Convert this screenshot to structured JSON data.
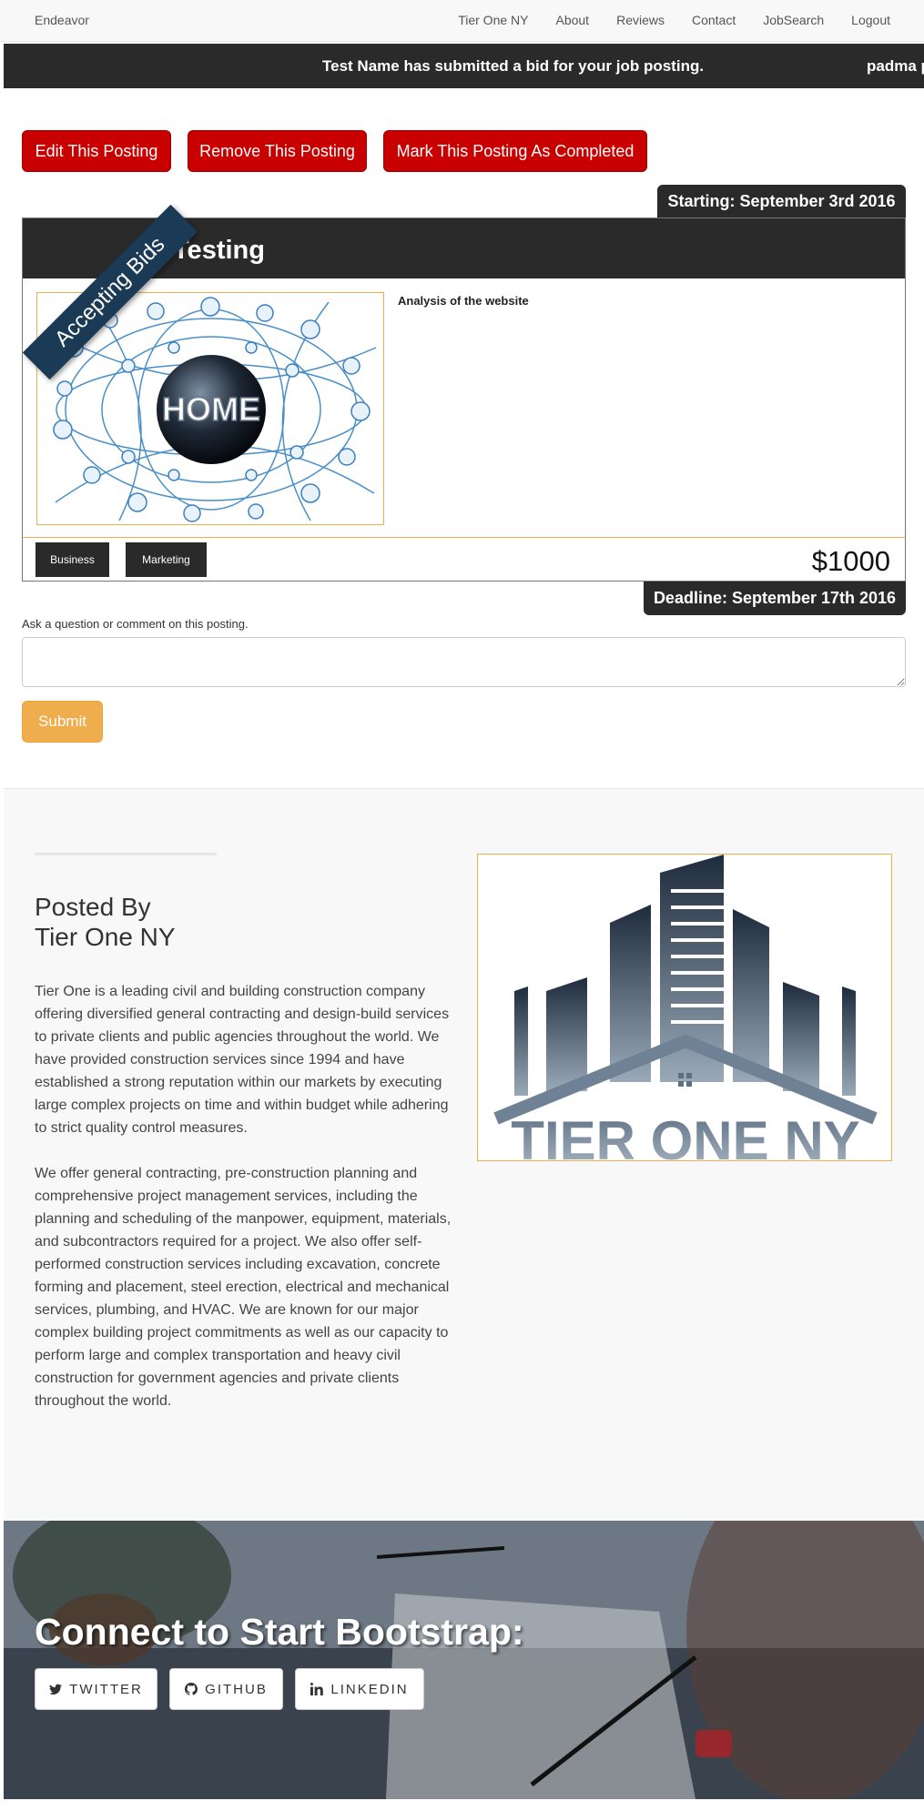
{
  "navbar": {
    "brand": "Endeavor",
    "links": [
      "Tier One NY",
      "About",
      "Reviews",
      "Contact",
      "JobSearch",
      "Logout"
    ]
  },
  "ticker": {
    "message": "Test Name has submitted a bid for your job posting.",
    "message_partial": "padma p"
  },
  "actions": {
    "edit": "Edit This Posting",
    "remove": "Remove This Posting",
    "complete": "Mark This Posting As Completed"
  },
  "posting": {
    "starting": "Starting: September 3rd 2016",
    "ribbon": "Accepting Bids",
    "title": "Testing",
    "image_text": "HOME",
    "description": "Analysis of the website",
    "categories": [
      "Business",
      "Marketing"
    ],
    "price": "$1000",
    "deadline": "Deadline: September 17th 2016"
  },
  "comment": {
    "label": "Ask a question or comment on this posting.",
    "placeholder": "",
    "submit": "Submit"
  },
  "posted_by": {
    "heading_line1": "Posted By",
    "heading_line2": "Tier One NY",
    "paragraph1": "Tier One is a leading civil and building construction company offering diversified general contracting and design-build services to private clients and public agencies throughout the world. We have provided construction services since 1994 and have established a strong reputation within our markets by executing large complex projects on time and within budget while adhering to strict quality control measures.",
    "paragraph2": "We offer general contracting, pre-construction planning and comprehensive project management services, including the planning and scheduling of the manpower, equipment, materials, and subcontractors required for a project. We also offer self-performed construction services including excavation, concrete forming and placement, steel erection, electrical and mechanical services, plumbing, and HVAC. We are known for our major complex building project commitments as well as our capacity to perform large and complex transportation and heavy civil construction for government agencies and private clients throughout the world.",
    "logo_text": "TIER ONE NY"
  },
  "connect": {
    "title": "Connect to Start Bootstrap:",
    "buttons": [
      {
        "label": "TWITTER",
        "icon": "twitter-icon"
      },
      {
        "label": "GITHUB",
        "icon": "github-icon"
      },
      {
        "label": "LINKEDIN",
        "icon": "linkedin-icon"
      }
    ]
  },
  "colors": {
    "dark": "#2a2a2a",
    "red_button": "#c80000",
    "orange": "#f0ad4e",
    "ribbon": "#1b3a55"
  }
}
